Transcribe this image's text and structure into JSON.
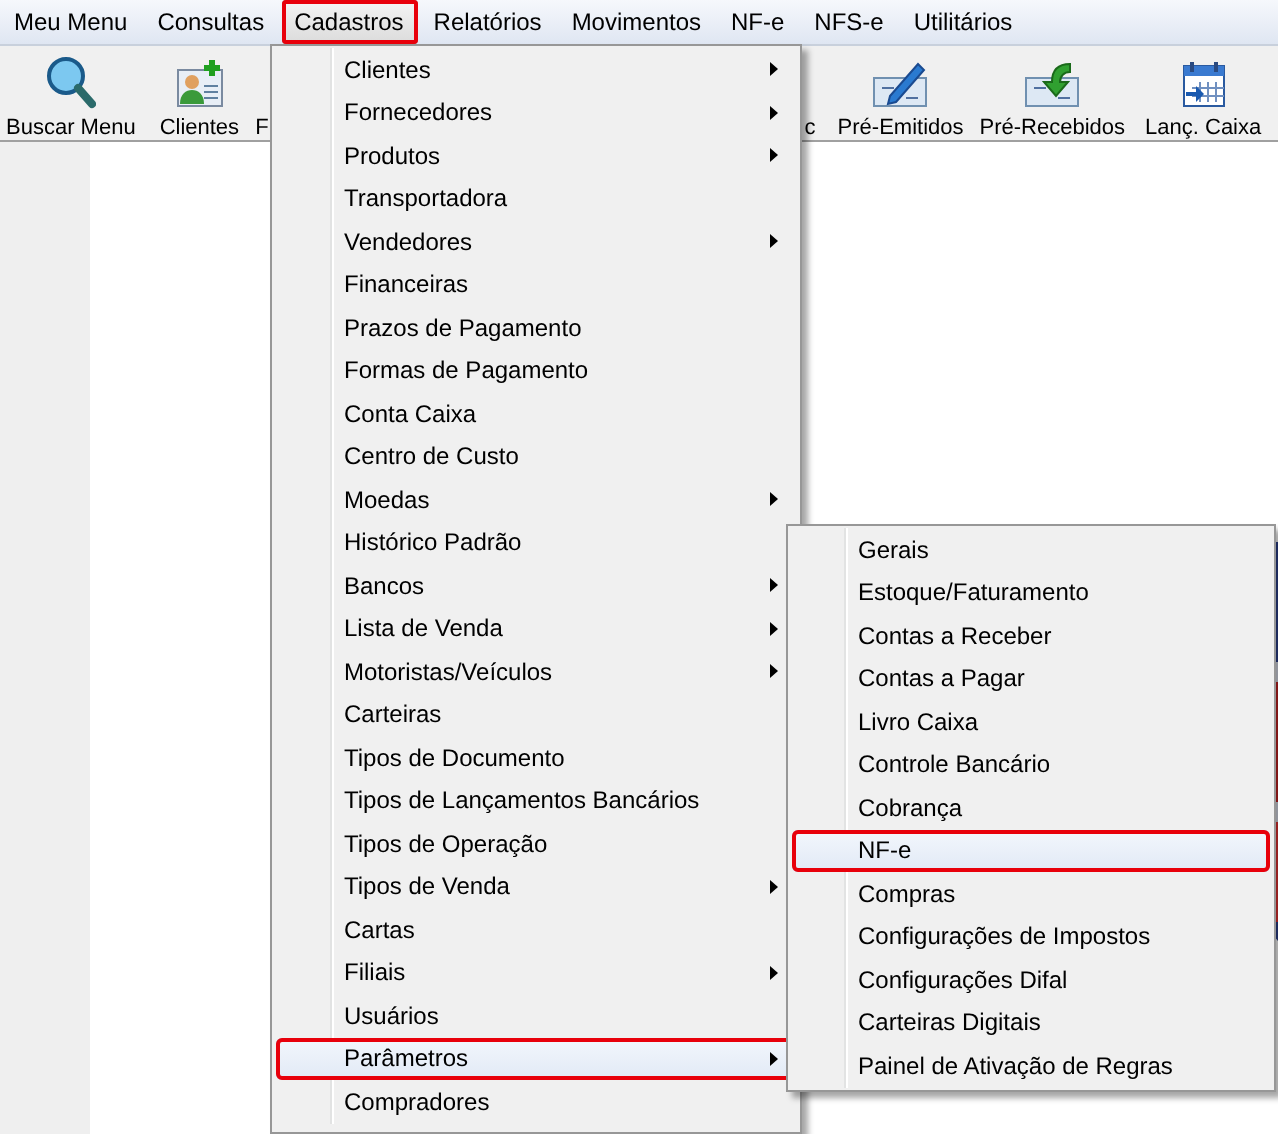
{
  "menu_bar": [
    {
      "label": "Meu Menu",
      "selected": false,
      "highlighted": false
    },
    {
      "label": "Consultas",
      "selected": false,
      "highlighted": false
    },
    {
      "label": "Cadastros",
      "selected": true,
      "highlighted": true
    },
    {
      "label": "Relatórios",
      "selected": false,
      "highlighted": false
    },
    {
      "label": "Movimentos",
      "selected": false,
      "highlighted": false
    },
    {
      "label": "NF-e",
      "selected": false,
      "highlighted": false
    },
    {
      "label": "NFS-e",
      "selected": false,
      "highlighted": false
    },
    {
      "label": "Utilitários",
      "selected": false,
      "highlighted": false
    }
  ],
  "toolbar": [
    {
      "label": "Buscar Menu"
    },
    {
      "label": "Clientes"
    },
    {
      "label": "F"
    },
    {
      "label": "c"
    },
    {
      "label": "Pré-Emitidos"
    },
    {
      "label": "Pré-Recebidos"
    },
    {
      "label": "Lanç. Caixa"
    }
  ],
  "cadastros_menu": [
    {
      "label": "Clientes",
      "has_submenu": true,
      "selected": false,
      "highlighted": false
    },
    {
      "label": "Fornecedores",
      "has_submenu": true,
      "selected": false,
      "highlighted": false
    },
    {
      "label": "Produtos",
      "has_submenu": true,
      "selected": false,
      "highlighted": false
    },
    {
      "label": "Transportadora",
      "has_submenu": false,
      "selected": false,
      "highlighted": false
    },
    {
      "label": "Vendedores",
      "has_submenu": true,
      "selected": false,
      "highlighted": false
    },
    {
      "label": "Financeiras",
      "has_submenu": false,
      "selected": false,
      "highlighted": false
    },
    {
      "label": "Prazos de Pagamento",
      "has_submenu": false,
      "selected": false,
      "highlighted": false
    },
    {
      "label": "Formas de Pagamento",
      "has_submenu": false,
      "selected": false,
      "highlighted": false
    },
    {
      "label": "Conta Caixa",
      "has_submenu": false,
      "selected": false,
      "highlighted": false
    },
    {
      "label": "Centro de Custo",
      "has_submenu": false,
      "selected": false,
      "highlighted": false
    },
    {
      "label": "Moedas",
      "has_submenu": true,
      "selected": false,
      "highlighted": false
    },
    {
      "label": "Histórico Padrão",
      "has_submenu": false,
      "selected": false,
      "highlighted": false
    },
    {
      "label": "Bancos",
      "has_submenu": true,
      "selected": false,
      "highlighted": false
    },
    {
      "label": "Lista de Venda",
      "has_submenu": true,
      "selected": false,
      "highlighted": false
    },
    {
      "label": "Motoristas/Veículos",
      "has_submenu": true,
      "selected": false,
      "highlighted": false
    },
    {
      "label": "Carteiras",
      "has_submenu": false,
      "selected": false,
      "highlighted": false
    },
    {
      "label": "Tipos de Documento",
      "has_submenu": false,
      "selected": false,
      "highlighted": false
    },
    {
      "label": "Tipos de Lançamentos Bancários",
      "has_submenu": false,
      "selected": false,
      "highlighted": false
    },
    {
      "label": "Tipos de Operação",
      "has_submenu": false,
      "selected": false,
      "highlighted": false
    },
    {
      "label": "Tipos de Venda",
      "has_submenu": true,
      "selected": false,
      "highlighted": false
    },
    {
      "label": "Cartas",
      "has_submenu": false,
      "selected": false,
      "highlighted": false
    },
    {
      "label": "Filiais",
      "has_submenu": true,
      "selected": false,
      "highlighted": false
    },
    {
      "label": "Usuários",
      "has_submenu": false,
      "selected": false,
      "highlighted": false
    },
    {
      "label": "Parâmetros",
      "has_submenu": true,
      "selected": true,
      "highlighted": true
    },
    {
      "label": "Compradores",
      "has_submenu": false,
      "selected": false,
      "highlighted": false
    }
  ],
  "parametros_submenu": [
    {
      "label": "Gerais",
      "selected": false,
      "highlighted": false
    },
    {
      "label": "Estoque/Faturamento",
      "selected": false,
      "highlighted": false
    },
    {
      "label": "Contas a Receber",
      "selected": false,
      "highlighted": false
    },
    {
      "label": "Contas a Pagar",
      "selected": false,
      "highlighted": false
    },
    {
      "label": "Livro Caixa",
      "selected": false,
      "highlighted": false
    },
    {
      "label": "Controle Bancário",
      "selected": false,
      "highlighted": false
    },
    {
      "label": "Cobrança",
      "selected": false,
      "highlighted": false
    },
    {
      "label": "NF-e",
      "selected": true,
      "highlighted": true
    },
    {
      "label": "Compras",
      "selected": false,
      "highlighted": false
    },
    {
      "label": "Configurações de Impostos",
      "selected": false,
      "highlighted": false
    },
    {
      "label": "Configurações Difal",
      "selected": false,
      "highlighted": false
    },
    {
      "label": "Carteiras Digitais",
      "selected": false,
      "highlighted": false
    },
    {
      "label": "Painel de Ativação de Regras",
      "selected": false,
      "highlighted": false
    }
  ]
}
